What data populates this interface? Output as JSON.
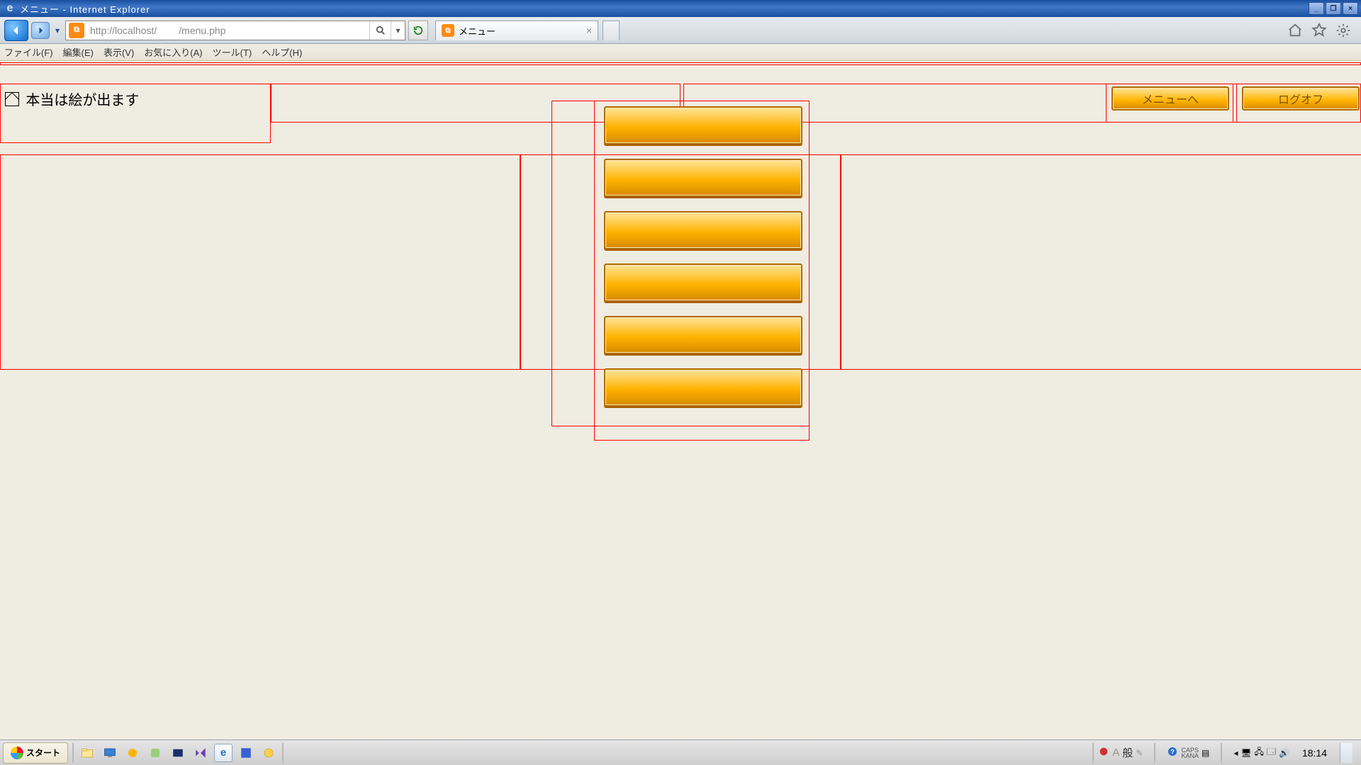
{
  "window": {
    "title": "メニュー - Internet Explorer",
    "min": "_",
    "max": "❐",
    "close": "×"
  },
  "address": {
    "url": "http://localhost/        /menu.php",
    "favicon": "⧉",
    "tab_title": "メニュー",
    "tab_close": "×"
  },
  "menubar": {
    "items": [
      "ファイル(F)",
      "編集(E)",
      "表示(V)",
      "お気に入り(A)",
      "ツール(T)",
      "ヘルプ(H)"
    ]
  },
  "page": {
    "placeholder_text": "本当は絵が出ます",
    "top_buttons": {
      "menu": "メニューへ",
      "logoff": "ログオフ"
    }
  },
  "taskbar": {
    "start": "スタート",
    "ime_mode": "A",
    "ime_kind": "般",
    "caps": "CAPS",
    "kana": "KANA",
    "clock": "18:14"
  }
}
